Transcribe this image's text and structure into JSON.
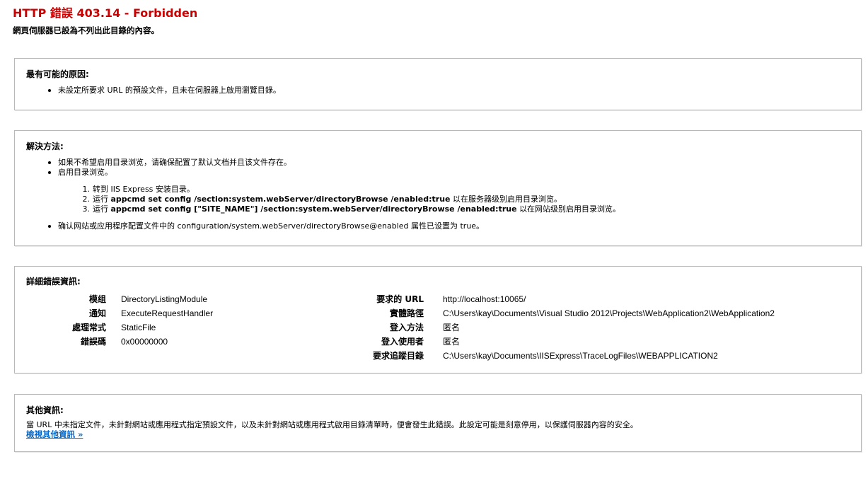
{
  "header": {
    "title": "HTTP 錯誤 403.14 - Forbidden",
    "subtitle": "網頁伺服器已設為不列出此目錄的內容。"
  },
  "causes": {
    "heading": "最有可能的原因:",
    "items": [
      "未設定所要求 URL 的預設文件，且未在伺服器上啟用瀏覽目錄。"
    ]
  },
  "solutions": {
    "heading": "解決方法:",
    "items": [
      "如果不希望启用目录浏览，请确保配置了默认文档并且该文件存在。",
      "启用目录浏览。"
    ],
    "steps": [
      {
        "num": "1.",
        "prefix": "转到 IIS Express 安装目录。",
        "cmd": "",
        "suffix": ""
      },
      {
        "num": "2.",
        "prefix": "运行",
        "cmd": "appcmd set config /section:system.webServer/directoryBrowse /enabled:true",
        "suffix": "以在服务器级别启用目录浏览。"
      },
      {
        "num": "3.",
        "prefix": "运行",
        "cmd": "appcmd set config [\"SITE_NAME\"] /section:system.webServer/directoryBrowse /enabled:true",
        "suffix": "以在网站级别启用目录浏览。"
      }
    ],
    "last_item": "确认网站或应用程序配置文件中的 configuration/system.webServer/directoryBrowse@enabled 属性已设置为 true。"
  },
  "details": {
    "heading": "詳細錯誤資訊:",
    "left": [
      {
        "label": "模组",
        "value": "DirectoryListingModule"
      },
      {
        "label": "通知",
        "value": "ExecuteRequestHandler"
      },
      {
        "label": "處理常式",
        "value": "StaticFile"
      },
      {
        "label": "錯誤碼",
        "value": "0x00000000"
      }
    ],
    "right": [
      {
        "label": "要求的 URL",
        "value": "http://localhost:10065/"
      },
      {
        "label": "實體路徑",
        "value": "C:\\Users\\kay\\Documents\\Visual Studio 2012\\Projects\\WebApplication2\\WebApplication2"
      },
      {
        "label": "登入方法",
        "value": "匿名"
      },
      {
        "label": "登入使用者",
        "value": "匿名"
      },
      {
        "label": "要求追蹤目錄",
        "value": "C:\\Users\\kay\\Documents\\IISExpress\\TraceLogFiles\\WEBAPPLICATION2"
      }
    ]
  },
  "more": {
    "heading": "其他資訊:",
    "text": "當 URL 中未指定文件，未針對網站或應用程式指定預設文件，以及未針對網站或應用程式啟用目錄清單時，便會發生此錯誤。此設定可能是刻意停用，以保護伺服器內容的安全。",
    "link": "檢視其他資訊 »"
  }
}
